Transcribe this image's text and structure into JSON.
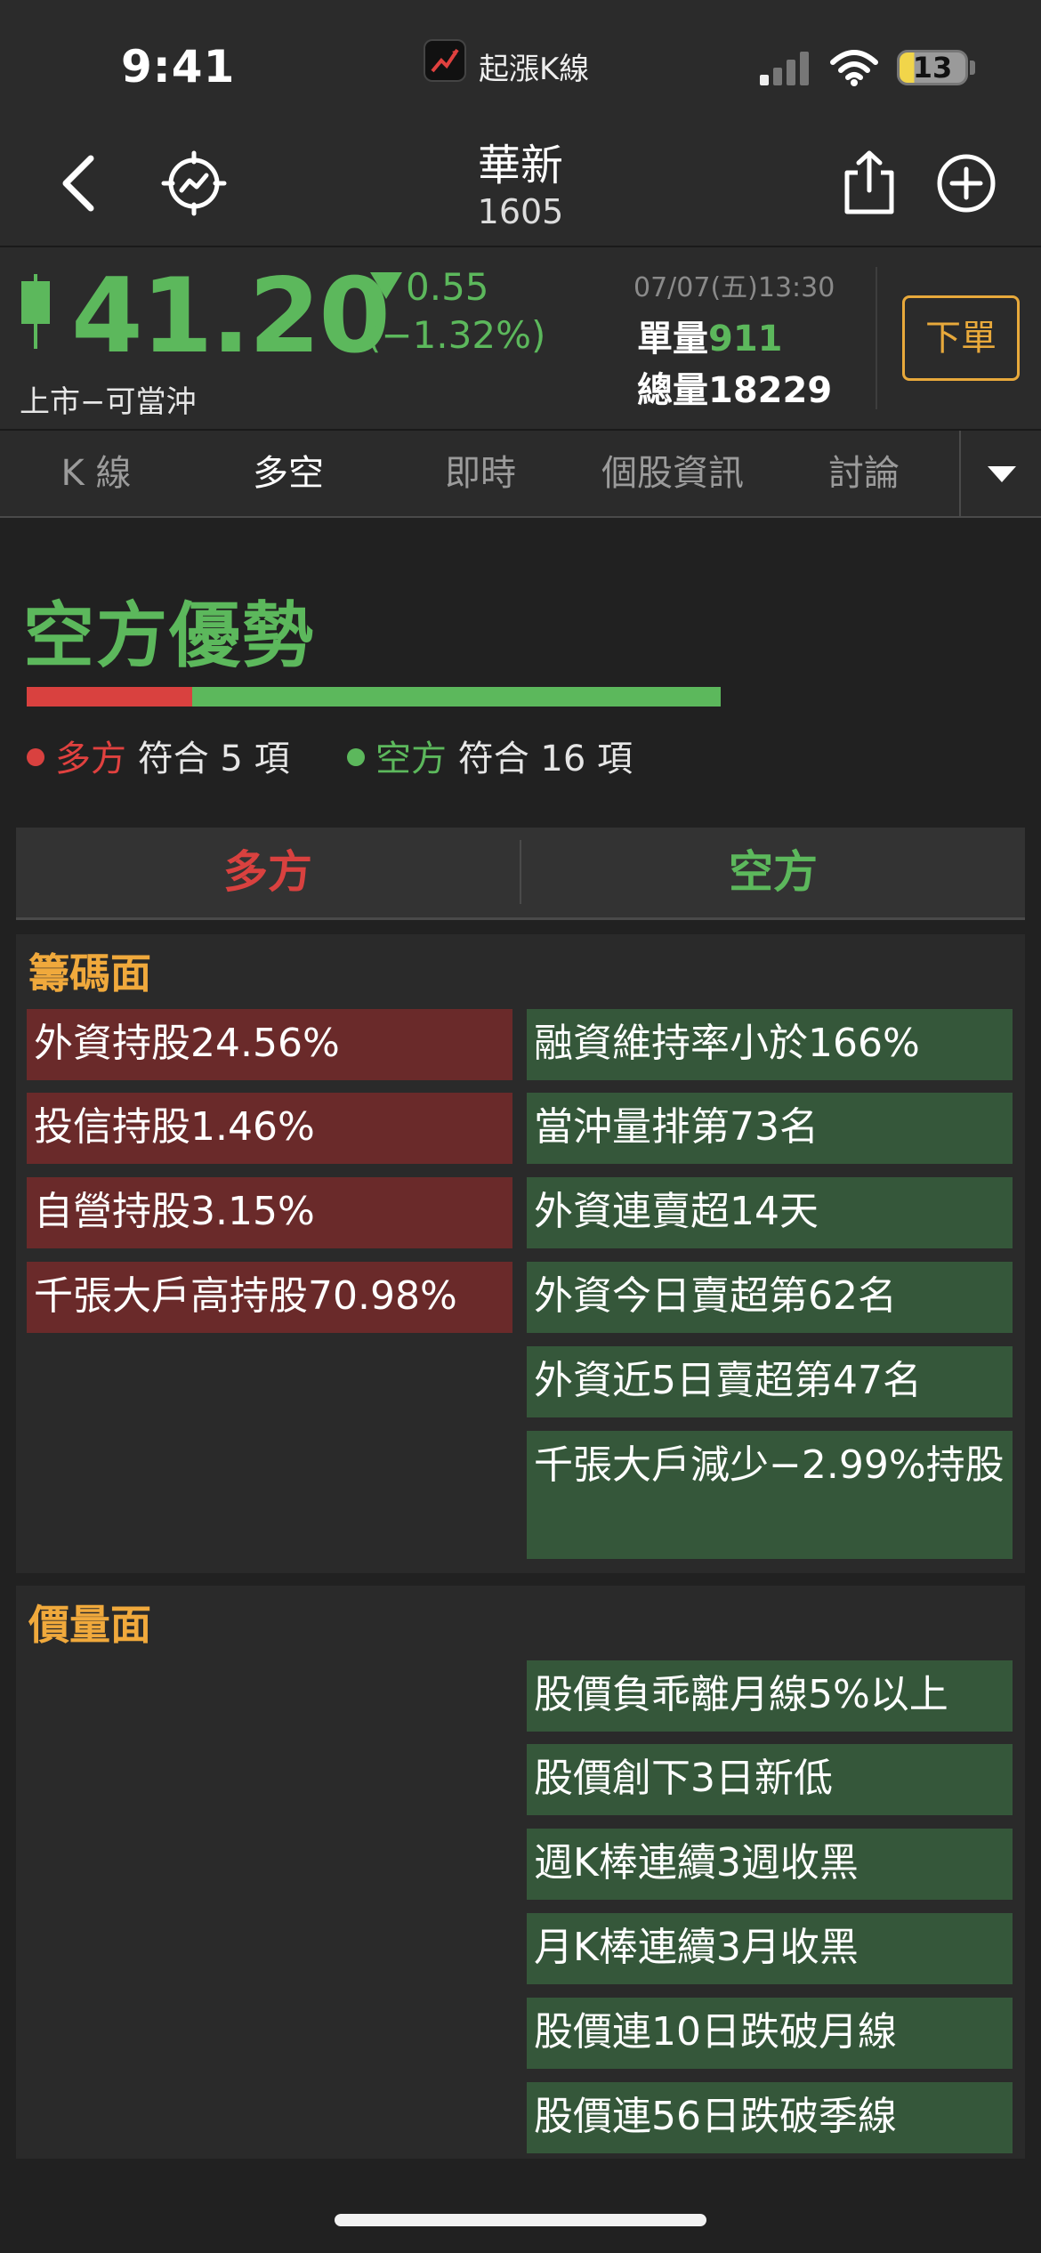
{
  "status_bar": {
    "time": "9:41",
    "app_name": "起漲K線",
    "battery": "13"
  },
  "header": {
    "stock_name": "華新",
    "stock_code": "1605"
  },
  "quote": {
    "price": "41.20",
    "change": "0.55",
    "change_pct": "(−1.32%)",
    "market_tag": "上市−可當沖",
    "datetime": "07/07(五)13:30",
    "unit_vol_label": "單量",
    "unit_vol": "911",
    "total_vol_label": "總量",
    "total_vol": "18229",
    "order_button": "下單",
    "color_down": "#5cb85c"
  },
  "tabs": [
    {
      "label": "K 線",
      "active": false
    },
    {
      "label": "多空",
      "active": true
    },
    {
      "label": "即時",
      "active": false
    },
    {
      "label": "個股資訊",
      "active": false
    },
    {
      "label": "討論",
      "active": false
    }
  ],
  "summary": {
    "title": "空方優勢",
    "bull_count": 5,
    "bear_count": 16,
    "bull_label": "多方",
    "bull_text": "符合 5 項",
    "bear_label": "空方",
    "bear_text": "符合 16 項",
    "color_bull": "#d9413f",
    "color_bear": "#5cb85c"
  },
  "columns": {
    "bull": "多方",
    "bear": "空方"
  },
  "sections": [
    {
      "title": "籌碼面",
      "bull": [
        "外資持股24.56%",
        "投信持股1.46%",
        "自營持股3.15%",
        "千張大戶高持股70.98%"
      ],
      "bear": [
        "融資維持率小於166%",
        "當沖量排第73名",
        "外資連賣超14天",
        "外資今日賣超第62名",
        "外資近5日賣超第47名",
        "千張大戶減少−2.99%持股"
      ]
    },
    {
      "title": "價量面",
      "bull": [],
      "bear": [
        "股價負乖離月線5%以上",
        "股價創下3日新低",
        "週K棒連續3週收黑",
        "月K棒連續3月收黑",
        "股價連10日跌破月線",
        "股價連56日跌破季線"
      ]
    }
  ],
  "icons": {
    "back": "chevron-left-icon",
    "radar": "radar-icon",
    "share": "share-icon",
    "add": "plus-circle-icon",
    "dropdown": "triangle-down-icon"
  }
}
